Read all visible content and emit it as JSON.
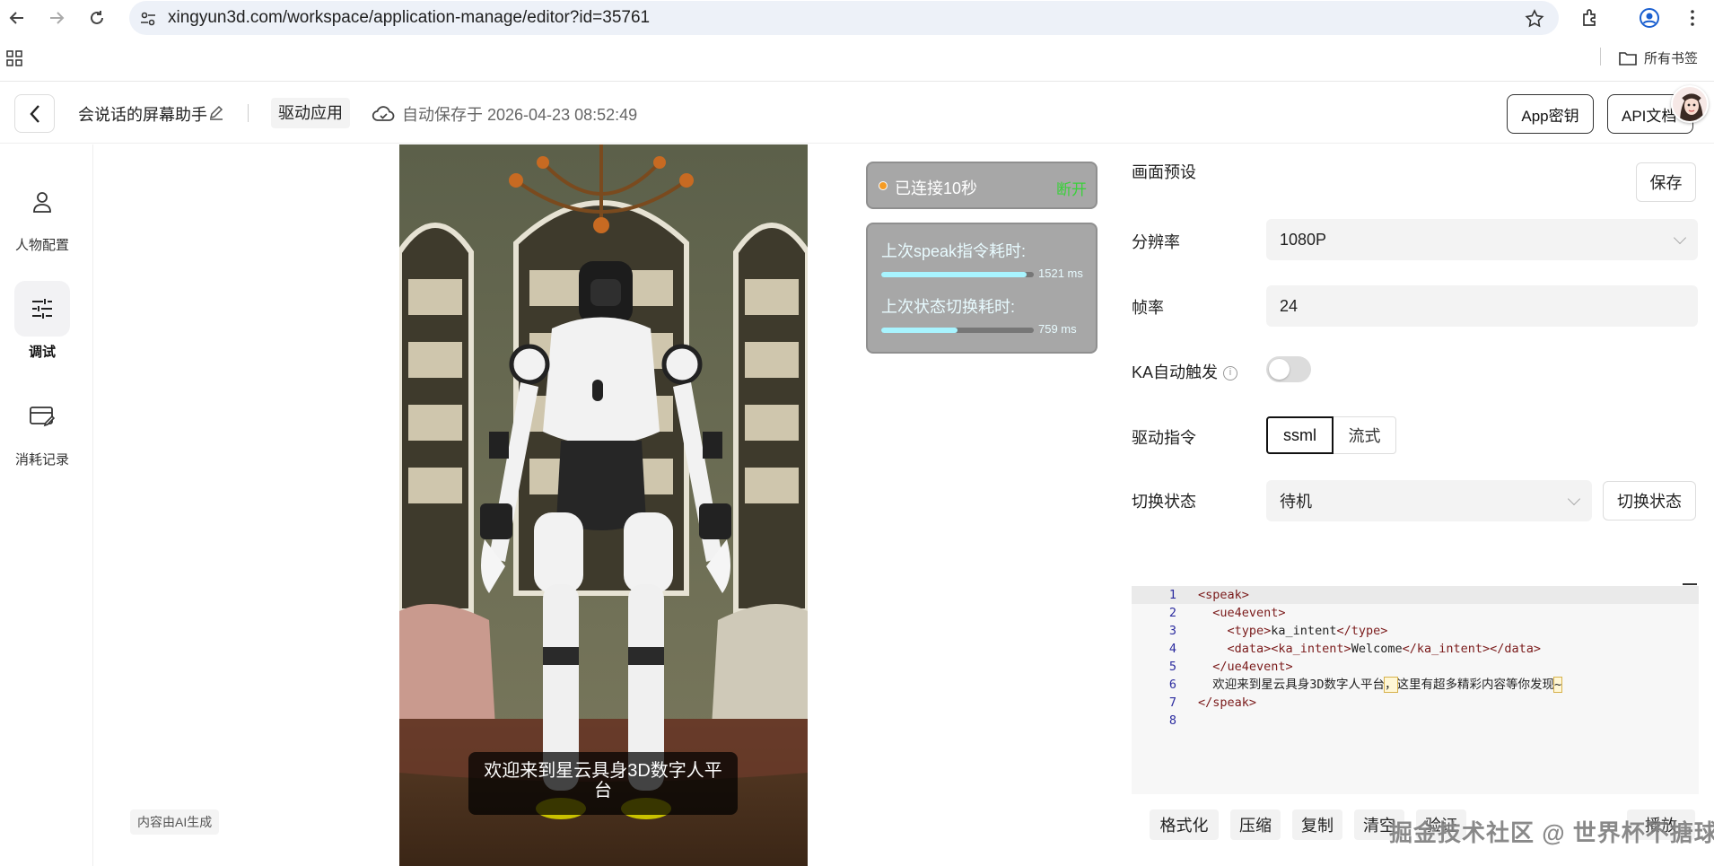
{
  "browser": {
    "url": "xingyun3d.com/workspace/application-manage/editor?id=35761",
    "bookmarks_label": "所有书签"
  },
  "header": {
    "app_name": "会说话的屏幕助手",
    "drive_tag": "驱动应用",
    "autosave": "自动保存于 2026-04-23 08:52:49",
    "app_key_button": "App密钥",
    "api_docs_button": "API文档"
  },
  "sidebar": {
    "items": [
      {
        "label": "人物配置",
        "icon": "person-icon"
      },
      {
        "label": "调试",
        "icon": "sliders-icon"
      },
      {
        "label": "消耗记录",
        "icon": "card-edit-icon"
      }
    ]
  },
  "preview": {
    "ai_badge": "内容由AI生成",
    "subtitle": "欢迎来到星云具身3D数字人平台"
  },
  "status": {
    "connection": "已连接10秒",
    "disconnect": "断开",
    "speak_label": "上次speak指令耗时:",
    "speak_value": "1521 ms",
    "speak_progress": 0.95,
    "switch_label": "上次状态切换耗时:",
    "switch_value": "759 ms",
    "switch_progress": 0.5
  },
  "settings": {
    "section_title": "画面预设",
    "save_button": "保存",
    "resolution_label": "分辨率",
    "resolution_value": "1080P",
    "fps_label": "帧率",
    "fps_value": "24",
    "ka_label": "KA自动触发",
    "ka_enabled": false,
    "drive_label": "驱动指令",
    "drive_options": [
      "ssml",
      "流式"
    ],
    "drive_selected": "ssml",
    "state_label": "切换状态",
    "state_value": "待机",
    "state_button": "切换状态"
  },
  "editor": {
    "lines": [
      {
        "num": "1",
        "indent": "",
        "parts": [
          [
            "tag",
            "<speak>"
          ]
        ]
      },
      {
        "num": "2",
        "indent": "  ",
        "parts": [
          [
            "tag",
            "<ue4event>"
          ]
        ]
      },
      {
        "num": "3",
        "indent": "    ",
        "parts": [
          [
            "tag",
            "<type>"
          ],
          [
            "txt",
            "ka_intent"
          ],
          [
            "tag",
            "</type>"
          ]
        ]
      },
      {
        "num": "4",
        "indent": "    ",
        "parts": [
          [
            "tag",
            "<data><ka_intent>"
          ],
          [
            "txt",
            "Welcome"
          ],
          [
            "tag",
            "</ka_intent></data>"
          ]
        ]
      },
      {
        "num": "5",
        "indent": "  ",
        "parts": [
          [
            "tag",
            "</ue4event>"
          ]
        ]
      },
      {
        "num": "6",
        "indent": "  ",
        "parts": [
          [
            "txt",
            "欢迎来到星云具身3D数字人平台"
          ],
          [
            "hl",
            "，"
          ],
          [
            "txt",
            "这里有超多精彩内容等你发现"
          ],
          [
            "hl",
            "~"
          ]
        ]
      },
      {
        "num": "7",
        "indent": "",
        "parts": [
          [
            "tag",
            "</speak>"
          ]
        ]
      },
      {
        "num": "8",
        "indent": "",
        "parts": []
      }
    ]
  },
  "toolbar": {
    "format": "格式化",
    "compress": "压缩",
    "copy": "复制",
    "clear": "清空",
    "validate": "验证",
    "play": "播放"
  },
  "watermark": "掘金技术社区 @ 世界杯不搪球",
  "colors": {
    "connected_dot": "#f59b23",
    "disconnect_text": "#3ad13a",
    "progress_fill": "#a8f4ff"
  }
}
